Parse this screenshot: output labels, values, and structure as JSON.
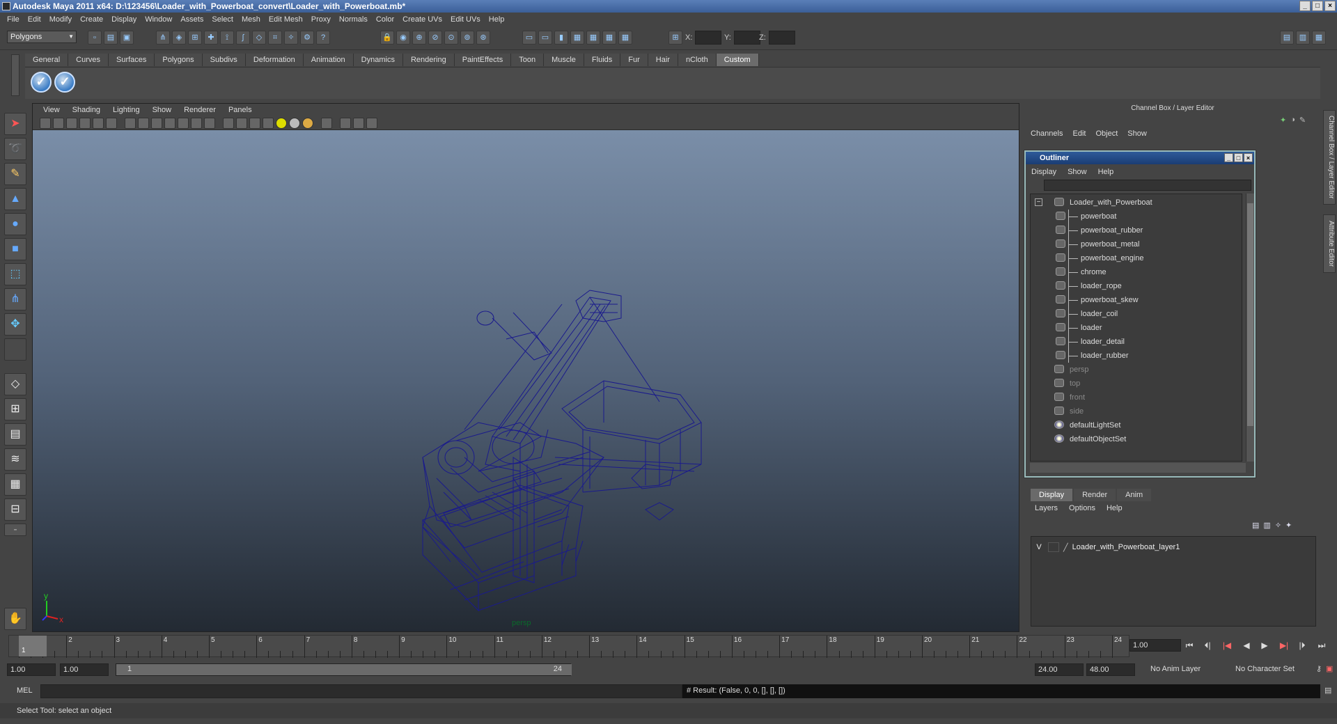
{
  "window": {
    "title": "Autodesk Maya 2011 x64: D:\\123456\\Loader_with_Powerboat_convert\\Loader_with_Powerboat.mb*",
    "buttons": [
      "_",
      "□",
      "×"
    ]
  },
  "menubar": [
    "File",
    "Edit",
    "Modify",
    "Create",
    "Display",
    "Window",
    "Assets",
    "Select",
    "Mesh",
    "Edit Mesh",
    "Proxy",
    "Normals",
    "Color",
    "Create UVs",
    "Edit UVs",
    "Help"
  ],
  "statusline": {
    "mode": "Polygons",
    "x_label": "X:",
    "y_label": "Y:",
    "z_label": "Z:"
  },
  "shelf": {
    "tabs": [
      "General",
      "Curves",
      "Surfaces",
      "Polygons",
      "Subdivs",
      "Deformation",
      "Animation",
      "Dynamics",
      "Rendering",
      "PaintEffects",
      "Toon",
      "Muscle",
      "Fluids",
      "Fur",
      "Hair",
      "nCloth",
      "Custom"
    ],
    "active_tab": "Custom"
  },
  "viewport": {
    "menu": [
      "View",
      "Shading",
      "Lighting",
      "Show",
      "Renderer",
      "Panels"
    ],
    "camera_label": "persp",
    "axis": {
      "x": "x",
      "y": "y"
    },
    "wire_color": "#1a1a8c"
  },
  "channelbox": {
    "header": "Channel Box / Layer Editor",
    "menu": [
      "Channels",
      "Edit",
      "Object",
      "Show"
    ]
  },
  "outliner": {
    "title": "Outliner",
    "menu": [
      "Display",
      "Show",
      "Help"
    ],
    "items": [
      {
        "label": "Loader_with_Powerboat",
        "type": "group"
      },
      {
        "label": "powerboat",
        "type": "child"
      },
      {
        "label": "powerboat_rubber",
        "type": "child"
      },
      {
        "label": "powerboat_metal",
        "type": "child"
      },
      {
        "label": "powerboat_engine",
        "type": "child"
      },
      {
        "label": "chrome",
        "type": "child"
      },
      {
        "label": "loader_rope",
        "type": "child"
      },
      {
        "label": "powerboat_skew",
        "type": "child"
      },
      {
        "label": "loader_coil",
        "type": "child"
      },
      {
        "label": "loader",
        "type": "child"
      },
      {
        "label": "loader_detail",
        "type": "child"
      },
      {
        "label": "loader_rubber",
        "type": "child"
      },
      {
        "label": "persp",
        "type": "camera"
      },
      {
        "label": "top",
        "type": "camera"
      },
      {
        "label": "front",
        "type": "camera"
      },
      {
        "label": "side",
        "type": "camera"
      },
      {
        "label": "defaultLightSet",
        "type": "set"
      },
      {
        "label": "defaultObjectSet",
        "type": "set"
      }
    ]
  },
  "layereditor": {
    "tabs": [
      "Display",
      "Render",
      "Anim"
    ],
    "active_tab": "Display",
    "menu": [
      "Layers",
      "Options",
      "Help"
    ],
    "layer": {
      "visible": "V",
      "name": "Loader_with_Powerboat_layer1"
    }
  },
  "side_tabs": [
    "Channel Box / Layer Editor",
    "Attribute Editor"
  ],
  "timeslider": {
    "frames": [
      "1",
      "2",
      "3",
      "4",
      "5",
      "6",
      "7",
      "8",
      "9",
      "10",
      "11",
      "12",
      "13",
      "14",
      "15",
      "16",
      "17",
      "18",
      "19",
      "20",
      "21",
      "22",
      "23",
      "24"
    ],
    "current_marker": "1",
    "current_frame": "1.00"
  },
  "range": {
    "start": "1.00",
    "playback_start": "1.00",
    "bar_start": "1",
    "bar_end": "24",
    "playback_end": "24.00",
    "end": "48.00",
    "anim_layer": "No Anim Layer",
    "character_set": "No Character Set"
  },
  "command": {
    "label": "MEL",
    "result": "# Result: (False, 0, 0, [], [], [])"
  },
  "helpline": "Select Tool: select an object"
}
